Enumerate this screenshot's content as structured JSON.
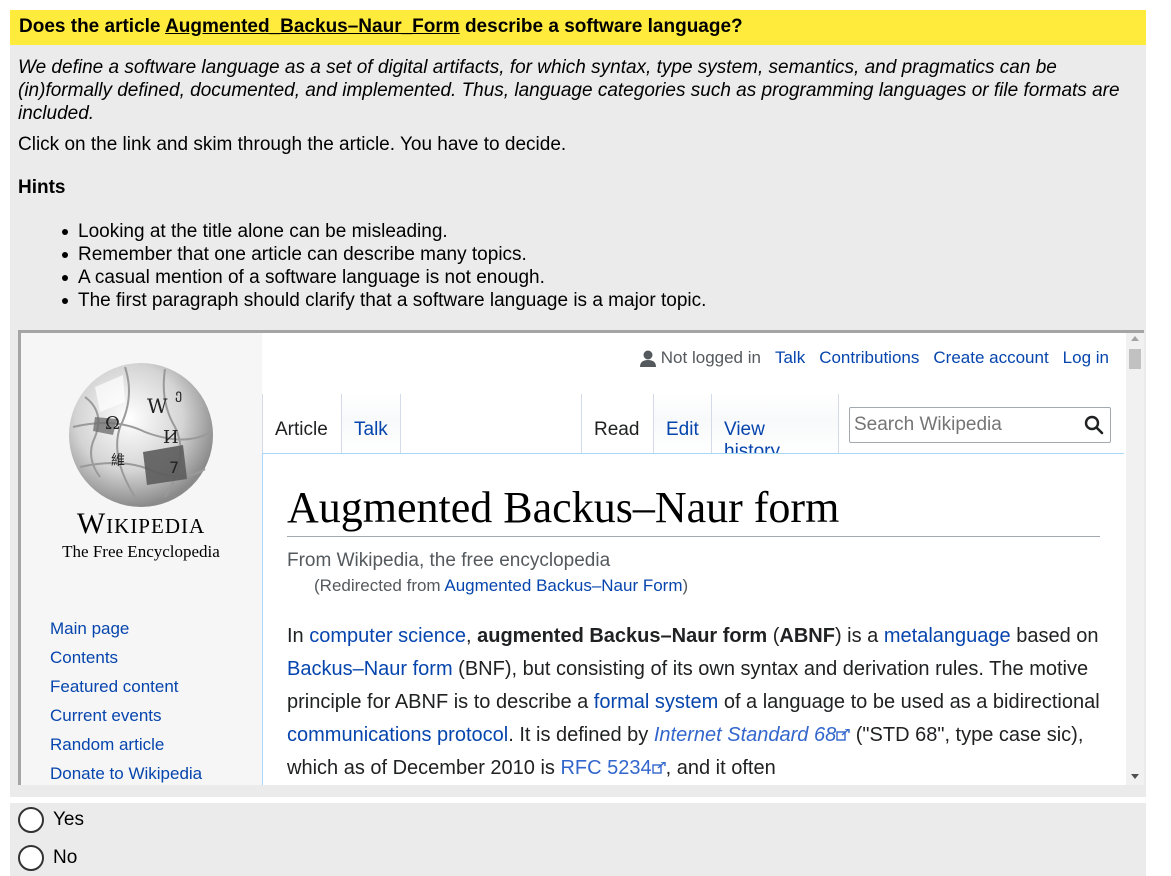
{
  "question": {
    "prefix": "Does the article ",
    "article_link": "Augmented_Backus–Naur_Form",
    "suffix": " describe a software language?"
  },
  "definition": "We define a software language as a set of digital artifacts, for which syntax, type system, semantics, and pragmatics can be (in)formally defined, documented, and implemented. Thus, language categories such as programming languages or file formats are included.",
  "instruction": "Click on the link and skim through the article. You have to decide.",
  "hints": {
    "title": "Hints",
    "items": [
      "Looking at the title alone can be misleading.",
      "Remember that one article can describe many topics.",
      "A casual mention of a software language is not enough.",
      "The first paragraph should clarify that a software language is a major topic."
    ]
  },
  "wiki": {
    "wordmark": "Wikipedia",
    "tagline": "The Free Encyclopedia",
    "nav": [
      "Main page",
      "Contents",
      "Featured content",
      "Current events",
      "Random article",
      "Donate to Wikipedia"
    ],
    "personal": {
      "not_logged_in": "Not logged in",
      "talk": "Talk",
      "contributions": "Contributions",
      "create_account": "Create account",
      "log_in": "Log in"
    },
    "tabs": {
      "article": "Article",
      "talk": "Talk",
      "read": "Read",
      "edit": "Edit",
      "view_history": "View history"
    },
    "search_placeholder": "Search Wikipedia",
    "title": "Augmented Backus–Naur form",
    "site_sub": "From Wikipedia, the free encyclopedia",
    "redirect": {
      "prefix": "(Redirected from ",
      "link": "Augmented Backus–Naur Form",
      "suffix": ")"
    },
    "lead": {
      "t1": "In ",
      "l1": "computer science",
      "t2": ", ",
      "b1": "augmented Backus–Naur form",
      "t3": " (",
      "b2": "ABNF",
      "t4": ") is a ",
      "l2": "metalanguage",
      "t5": " based on ",
      "l3": "Backus–Naur form",
      "t6": " (BNF), but consisting of its own syntax and derivation rules. The motive principle for ABNF is to describe a ",
      "l4": "formal system",
      "t7": " of a language to be used as a bidirectional ",
      "l5": "communications protocol",
      "t8": ". It is defined by ",
      "l6": "Internet Standard 68",
      "t9": " (\"STD 68\", type case sic), which as of December 2010 is ",
      "l7": "RFC 5234",
      "t10": ", and it often"
    }
  },
  "answers": {
    "yes": "Yes",
    "no": "No"
  }
}
